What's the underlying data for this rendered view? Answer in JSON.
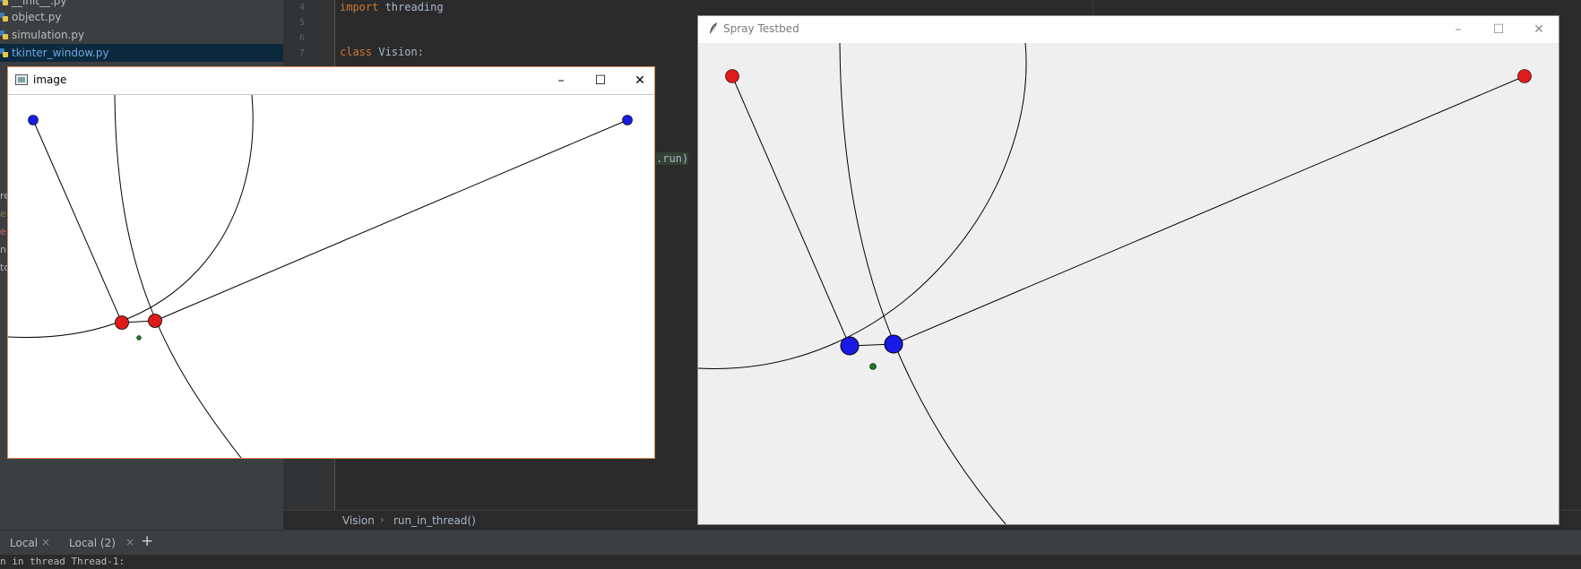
{
  "ide": {
    "project_files": [
      {
        "label": "__init__.py"
      },
      {
        "label": "object.py"
      },
      {
        "label": "simulation.py"
      },
      {
        "label": "tkinter_window.py",
        "selected": true
      }
    ],
    "side_fragments": [
      "re",
      "e",
      "e",
      "n",
      "rr",
      "to"
    ],
    "line_numbers": [
      "4",
      "5",
      "6",
      "7"
    ],
    "code": {
      "line1_kw": "import",
      "line1_rest": " threading",
      "line2_kw": "class",
      "line2_rest": " Vision:",
      "fragment": ".run)"
    },
    "breadcrumb": {
      "class": "Vision",
      "sep": "›",
      "method": "run_in_thread()"
    },
    "terminal_tabs": [
      {
        "label": "Local",
        "close": "×"
      },
      {
        "label": "Local (2)",
        "close": "×"
      }
    ],
    "add_tab": "+",
    "terminal_text": "n in thread Thread-1:"
  },
  "cv_window": {
    "title": "image",
    "minimize": "–",
    "maximize": "☐",
    "close": "✕",
    "colors": {
      "background": "#ffffff",
      "endpoint": "#1a1ae6",
      "joint": "#e01b1b",
      "target": "#1f7a1f"
    }
  },
  "tk_window": {
    "title": "Spray Testbed",
    "minimize": "–",
    "maximize": "☐",
    "close": "✕",
    "colors": {
      "background": "#efefef",
      "endpoint": "#e01b1b",
      "joint": "#1a1ae6",
      "target": "#1f7a1f"
    }
  }
}
